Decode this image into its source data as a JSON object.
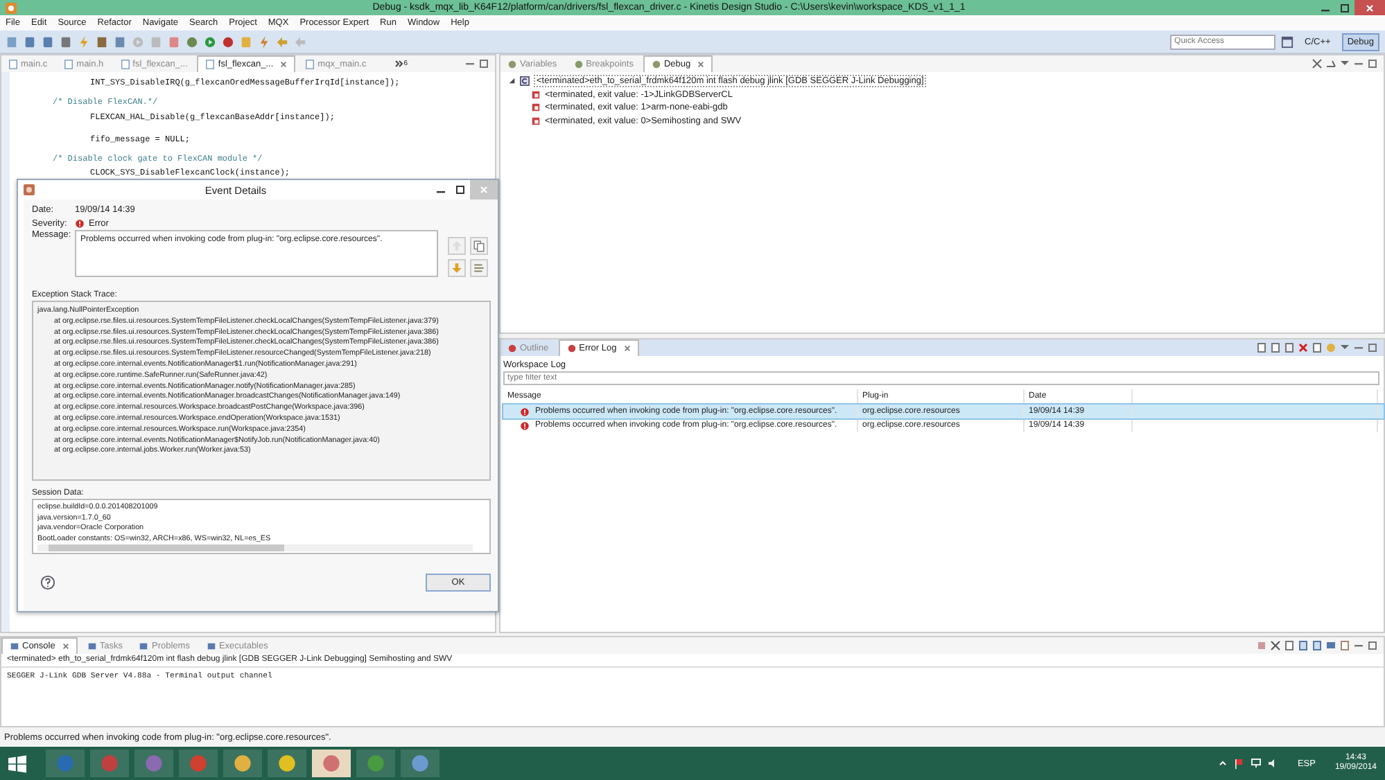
{
  "window": {
    "title": "Debug - ksdk_mqx_lib_K64F12/platform/can/drivers/fsl_flexcan_driver.c - Kinetis Design Studio - C:\\Users\\kevin\\workspace_KDS_v1_1_1"
  },
  "menu": [
    "File",
    "Edit",
    "Source",
    "Refactor",
    "Navigate",
    "Search",
    "Project",
    "MQX",
    "Processor Expert",
    "Run",
    "Window",
    "Help"
  ],
  "toolbar": {
    "quick_access_placeholder": "Quick Access",
    "perspectives": [
      {
        "label": "C/C++",
        "selected": false
      },
      {
        "label": "Debug",
        "selected": true
      }
    ]
  },
  "editor": {
    "tabs": [
      {
        "label": "main.c",
        "selected": false
      },
      {
        "label": "main.h",
        "selected": false
      },
      {
        "label": "fsl_flexcan_...",
        "selected": false
      },
      {
        "label": "fsl_flexcan_...",
        "selected": true
      },
      {
        "label": "mqx_main.c",
        "selected": false
      }
    ],
    "overflow_count": "6",
    "blocks": [
      [
        {
          "text": "INT_SYS_DisableIRQ(g_flexcanOredMessageBufferIrqId[instance]);",
          "kind": "code"
        }
      ],
      [
        {
          "text": "/* Disable FlexCAN.*/",
          "kind": "comment"
        },
        {
          "text": "FLEXCAN_HAL_Disable(g_flexcanBaseAddr[instance]);",
          "kind": "code"
        }
      ],
      [
        {
          "text": "fifo_message = NULL;",
          "kind": "code"
        }
      ],
      [
        {
          "text": "/* Disable clock gate to FlexCAN module */",
          "kind": "comment"
        },
        {
          "text": "CLOCK_SYS_DisableFlexcanClock(instance);",
          "kind": "code"
        }
      ]
    ]
  },
  "debug_view": {
    "tabs": [
      {
        "label": "Variables",
        "selected": false
      },
      {
        "label": "Breakpoints",
        "selected": false
      },
      {
        "label": "Debug",
        "selected": true
      }
    ],
    "tree": {
      "label": "<terminated>eth_to_serial_frdmk64f120m int flash debug jlink [GDB SEGGER J-Link Debugging]",
      "expanded": true,
      "selected": true,
      "children": [
        {
          "label": "<terminated, exit value: -1>JLinkGDBServerCL",
          "selected": false
        },
        {
          "label": "<terminated, exit value: 1>arm-none-eabi-gdb",
          "selected": false
        },
        {
          "label": "<terminated, exit value: 0>Semihosting and SWV",
          "selected": false
        }
      ]
    }
  },
  "error_log": {
    "tabs": [
      {
        "label": "Outline",
        "selected": false
      },
      {
        "label": "Error Log",
        "selected": true
      }
    ],
    "log_title": "Workspace Log",
    "filter_placeholder": "type filter text",
    "columns": [
      "Message",
      "Plug-in",
      "Date"
    ],
    "rows": [
      {
        "message": "Problems occurred when invoking code from plug-in: \"org.eclipse.core.resources\".",
        "plugin": "org.eclipse.core.resources",
        "date": "19/09/14 14:39",
        "selected": true
      },
      {
        "message": "Problems occurred when invoking code from plug-in: \"org.eclipse.core.resources\".",
        "plugin": "org.eclipse.core.resources",
        "date": "19/09/14 14:39",
        "selected": false
      }
    ]
  },
  "dialog": {
    "title": "Event Details",
    "date_label": "Date:",
    "date": "19/09/14 14:39",
    "severity_label": "Severity:",
    "severity": "Error",
    "message_label": "Message:",
    "message": "Problems occurred when invoking code from plug-in: \"org.eclipse.core.resources\".",
    "stack_label": "Exception Stack Trace:",
    "stack": [
      {
        "text": "java.lang.NullPointerException",
        "kind": "exception"
      },
      {
        "text": "at org.eclipse.rse.files.ui.resources.SystemTempFileListener.checkLocalChanges(SystemTempFileListener.java:379)",
        "kind": "frame"
      },
      {
        "text": "at org.eclipse.rse.files.ui.resources.SystemTempFileListener.checkLocalChanges(SystemTempFileListener.java:386)",
        "kind": "frame"
      },
      {
        "text": "at org.eclipse.rse.files.ui.resources.SystemTempFileListener.checkLocalChanges(SystemTempFileListener.java:386)",
        "kind": "frame"
      },
      {
        "text": "at org.eclipse.rse.files.ui.resources.SystemTempFileListener.resourceChanged(SystemTempFileListener.java:218)",
        "kind": "frame"
      },
      {
        "text": "at org.eclipse.core.internal.events.NotificationManager$1.run(NotificationManager.java:291)",
        "kind": "frame"
      },
      {
        "text": "at org.eclipse.core.runtime.SafeRunner.run(SafeRunner.java:42)",
        "kind": "frame"
      },
      {
        "text": "at org.eclipse.core.internal.events.NotificationManager.notify(NotificationManager.java:285)",
        "kind": "frame"
      },
      {
        "text": "at org.eclipse.core.internal.events.NotificationManager.broadcastChanges(NotificationManager.java:149)",
        "kind": "frame"
      },
      {
        "text": "at org.eclipse.core.internal.resources.Workspace.broadcastPostChange(Workspace.java:396)",
        "kind": "frame"
      },
      {
        "text": "at org.eclipse.core.internal.resources.Workspace.endOperation(Workspace.java:1531)",
        "kind": "frame"
      },
      {
        "text": "at org.eclipse.core.internal.resources.Workspace.run(Workspace.java:2354)",
        "kind": "frame"
      },
      {
        "text": "at org.eclipse.core.internal.events.NotificationManager$NotifyJob.run(NotificationManager.java:40)",
        "kind": "frame"
      },
      {
        "text": "at org.eclipse.core.internal.jobs.Worker.run(Worker.java:53)",
        "kind": "frame"
      }
    ],
    "session_label": "Session Data:",
    "session": [
      "eclipse.buildId=0.0.0.201408201009",
      "java.version=1.7.0_60",
      "java.vendor=Oracle Corporation",
      "BootLoader constants: OS=win32, ARCH=x86, WS=win32, NL=es_ES"
    ],
    "ok": "OK"
  },
  "console": {
    "tabs": [
      {
        "label": "Console",
        "selected": true
      },
      {
        "label": "Tasks",
        "selected": false
      },
      {
        "label": "Problems",
        "selected": false
      },
      {
        "label": "Executables",
        "selected": false
      }
    ],
    "header": "<terminated> eth_to_serial_frdmk64f120m int flash debug jlink [GDB SEGGER J-Link Debugging] Semihosting and SWV",
    "lines": [
      "SEGGER J-Link GDB Server V4.88a - Terminal output channel"
    ]
  },
  "status_bar": {
    "text": "Problems occurred when invoking code from plug-in: \"org.eclipse.core.resources\"."
  },
  "taskbar": {
    "language": "ESP",
    "time": "14:43",
    "date": "19/09/2014"
  }
}
